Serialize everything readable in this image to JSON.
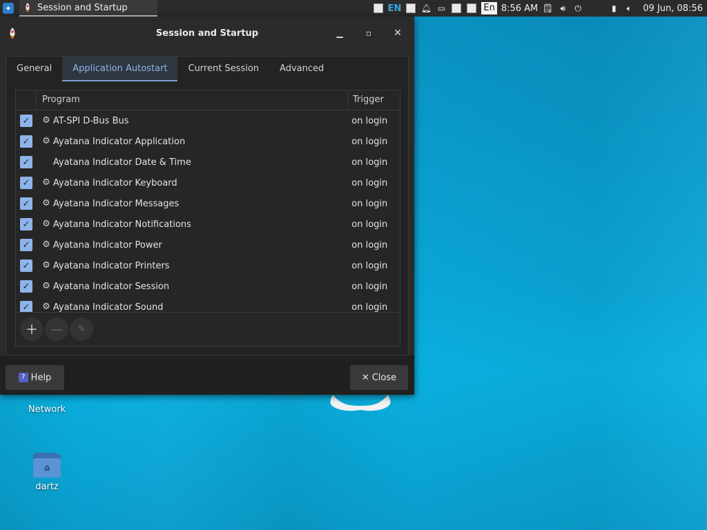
{
  "panel": {
    "task_title": "Session and Startup",
    "tray": {
      "layout_indicator": "EN",
      "keyboard_box": "En",
      "time": "8:56 AM",
      "datetime": "09 Jun, 08:56"
    }
  },
  "window": {
    "title": "Session and Startup",
    "tabs": [
      "General",
      "Application Autostart",
      "Current Session",
      "Advanced"
    ],
    "active_tab": "Application Autostart",
    "columns": {
      "program": "Program",
      "trigger": "Trigger"
    },
    "rows": [
      {
        "name": "AT-SPI D-Bus Bus",
        "trigger": "on login",
        "checked": true,
        "icon": "gear-icon"
      },
      {
        "name": "Ayatana Indicator Application",
        "trigger": "on login",
        "checked": true,
        "icon": "gear-icon"
      },
      {
        "name": "Ayatana Indicator Date & Time",
        "trigger": "on login",
        "checked": true,
        "icon": ""
      },
      {
        "name": "Ayatana Indicator Keyboard",
        "trigger": "on login",
        "checked": true,
        "icon": "gear-icon"
      },
      {
        "name": "Ayatana Indicator Messages",
        "trigger": "on login",
        "checked": true,
        "icon": "gear-icon"
      },
      {
        "name": "Ayatana Indicator Notifications",
        "trigger": "on login",
        "checked": true,
        "icon": "gear-icon"
      },
      {
        "name": "Ayatana Indicator Power",
        "trigger": "on login",
        "checked": true,
        "icon": "gear-icon"
      },
      {
        "name": "Ayatana Indicator Printers",
        "trigger": "on login",
        "checked": true,
        "icon": "gear-icon"
      },
      {
        "name": "Ayatana Indicator Session",
        "trigger": "on login",
        "checked": true,
        "icon": "gear-icon"
      },
      {
        "name": "Ayatana Indicator Sound",
        "trigger": "on login",
        "checked": true,
        "icon": "gear-icon"
      }
    ],
    "help_label": "Help",
    "close_label": "Close"
  },
  "desktop": {
    "network_label": "Network",
    "home_label": "dartz"
  },
  "colors": {
    "accent": "#8fb4ea",
    "desktop": "#0aa6d6",
    "window_bg": "#2b2b2b"
  }
}
